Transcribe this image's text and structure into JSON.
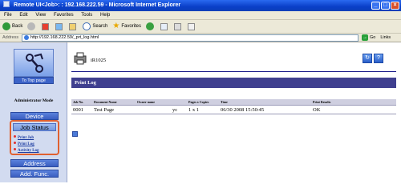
{
  "window": {
    "title": "Remote UI<Job>: : 192.168.222.59 - Microsoft Internet Explorer"
  },
  "menu": [
    "File",
    "Edit",
    "View",
    "Favorites",
    "Tools",
    "Help"
  ],
  "toolbar": {
    "back_label": "Back",
    "search_label": "Search",
    "favorites_label": "Favorites"
  },
  "address": {
    "label": "Address",
    "url": "http://192.168.222.59/_prt_log.html",
    "go_label": "Go",
    "links_label": "Links"
  },
  "sidebar": {
    "top_page_label": "To Top page",
    "mode_label": "Administrator Mode",
    "device_label": "Device",
    "job_status_label": "Job Status",
    "job_links": [
      "Print Job",
      "Print Log",
      "Activity Log"
    ],
    "address_label": "Address",
    "add_func_label": "Add. Func."
  },
  "main": {
    "device_name": "iR1025",
    "section_title": "Print Log",
    "table": {
      "headers": [
        "Job No.",
        "Document Name",
        "Owner name",
        "",
        "Pages x Copies",
        "Time",
        "Print Results"
      ],
      "rows": [
        [
          "0001",
          "Test Page",
          "",
          "yc",
          "1 x 1",
          "06/30 2008 15:50:45",
          "OK"
        ]
      ]
    }
  },
  "colors": {
    "title_bar": "#0a3fc8",
    "section_bar": "#3f3f8f",
    "sidebar_bg": "#d2dbf0",
    "highlight_border": "#e06030"
  }
}
